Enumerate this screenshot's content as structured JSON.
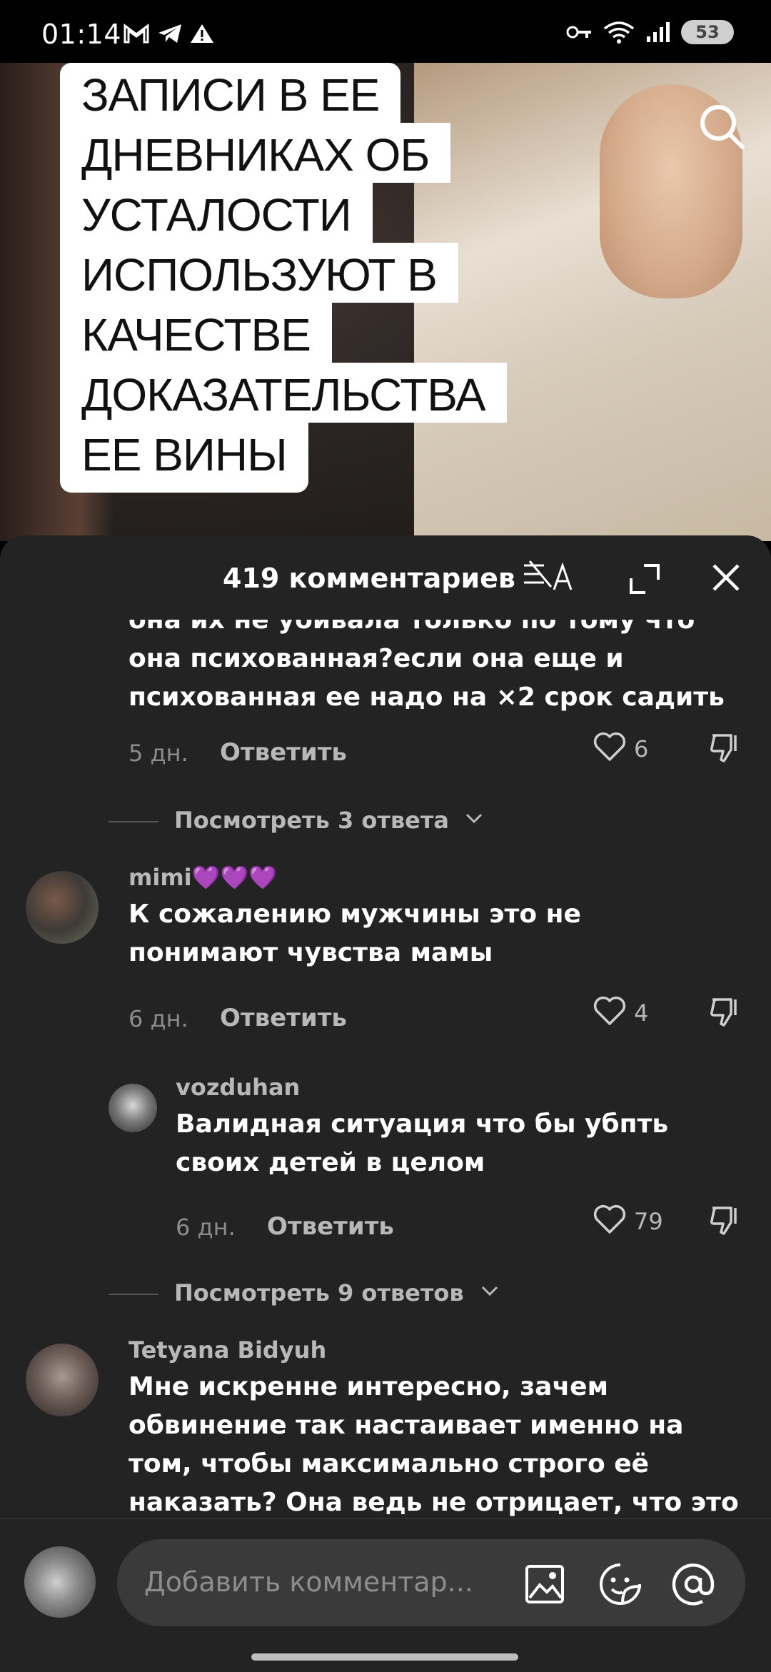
{
  "status_bar": {
    "time": "01:14",
    "battery": "53"
  },
  "video": {
    "caption_lines": [
      "ЗАПИСИ В ЕЕ",
      "ДНЕВНИКАХ ОБ",
      "УСТАЛОСТИ",
      "ИСПОЛЬЗУЮТ В",
      "КАЧЕСТВЕ",
      "ДОКАЗАТЕЛЬСТВА",
      "ЕЕ ВИНЫ"
    ]
  },
  "comments_sheet": {
    "title": "419 комментариев",
    "comments": [
      {
        "text_partial_top": "она их не убивала только по тому что",
        "text_lines": [
          "она психованная?если она еще и",
          "психованная ее надо на ×2 срок садить"
        ],
        "time": "5 дн.",
        "reply_label": "Ответить",
        "likes": "6"
      },
      {
        "view_replies": "Посмотреть 3 ответа"
      },
      {
        "username": "mimi💜💜💜",
        "text_lines": [
          "К сожалению мужчины это не",
          "понимают чувства мамы"
        ],
        "time": "6 дн.",
        "reply_label": "Ответить",
        "likes": "4"
      },
      {
        "username": "vozduhan",
        "text_lines": [
          "Валидная ситуация что бы убпть",
          "своих детей в целом"
        ],
        "time": "6 дн.",
        "reply_label": "Ответить",
        "likes": "79"
      },
      {
        "view_replies": "Посмотреть 9 ответов"
      },
      {
        "username": "Tetyana Bidyuh",
        "text_lines": [
          "Мне искренне интересно, зачем",
          "обвинение так настаивает именно на",
          "том, чтобы максимально строго её",
          "наказать? Она ведь не отрицает, что это"
        ]
      }
    ]
  },
  "comment_input": {
    "placeholder": "Добавить комментар..."
  }
}
